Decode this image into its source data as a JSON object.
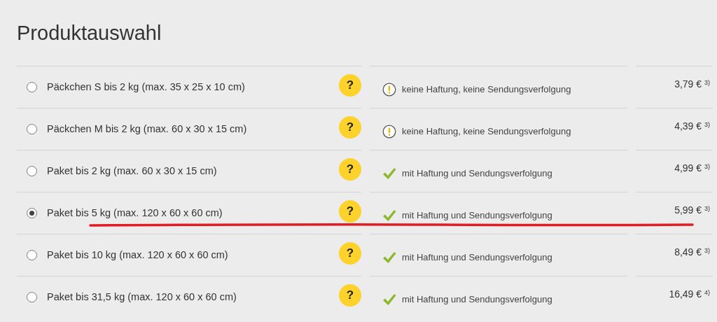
{
  "title": "Produktauswahl",
  "products": [
    {
      "label": "Päckchen S bis 2 kg (max. 35 x 25 x 10 cm)",
      "selected": false,
      "help": "?",
      "kind": "warning",
      "info": "keine Haftung, keine Sendungsverfolgung",
      "price": "3,79 € $^{3)}$"
    },
    {
      "label": "Päckchen M bis 2 kg (max. 60 x 30 x 15 cm)",
      "selected": false,
      "help": "?",
      "kind": "warning",
      "info": "keine Haftung, keine Sendungsverfolgung",
      "price": "4,39 € $^{3)}$"
    },
    {
      "label": "Paket bis 2 kg (max. 60 x 30 x 15 cm)",
      "selected": false,
      "help": "?",
      "kind": "check",
      "info": "mit Haftung und Sendungsverfolgung",
      "price": "4,99 € $^{3)}$"
    },
    {
      "label": "Paket bis 5 kg (max. 120 x 60 x 60 cm)",
      "selected": true,
      "help": "?",
      "kind": "check",
      "info": "mit Haftung und Sendungsverfolgung",
      "price": "5,99 € $^{3)}$"
    },
    {
      "label": "Paket bis 10 kg (max. 120 x 60 x 60 cm)",
      "selected": false,
      "help": "?",
      "kind": "check",
      "info": "mit Haftung und Sendungsverfolgung",
      "price": "8,49 € $^{3)}$"
    },
    {
      "label": "Paket bis 31,5 kg (max. 120 x 60 x 60 cm)",
      "selected": false,
      "help": "?",
      "kind": "check",
      "info": "mit Haftung und Sendungsverfolgung",
      "price": "16,49 € $^{4)}$"
    }
  ]
}
